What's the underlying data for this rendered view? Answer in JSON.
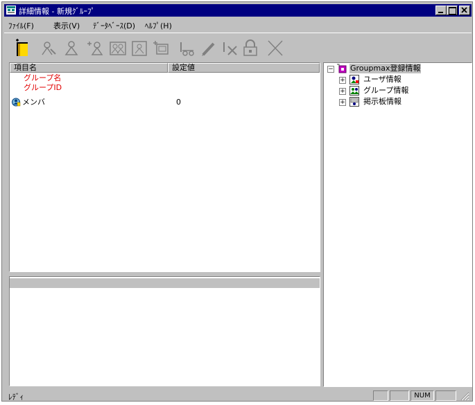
{
  "window": {
    "title": "詳細情報 - 新規ｸﾞﾙｰﾌﾟ"
  },
  "menu": [
    {
      "label": "ﾌｧｲﾙ(F)"
    },
    {
      "label": "表示(V)"
    },
    {
      "label": "ﾃﾞｰﾀﾍﾞｰｽ(D)"
    },
    {
      "label": "ﾍﾙﾌﾟ(H)"
    }
  ],
  "list": {
    "columns": [
      "項目名",
      "設定値"
    ],
    "rows": [
      {
        "name": "グループ名",
        "value": "",
        "color": "#e00000"
      },
      {
        "name": "グループID",
        "value": "",
        "color": "#e00000"
      },
      {
        "name": "メンバ",
        "value": "0",
        "icon": "member-icon"
      }
    ]
  },
  "tree": {
    "root": "Groupmax登録情報",
    "children": [
      {
        "label": "ユーザ情報",
        "icon": "user-info-icon"
      },
      {
        "label": "グループ情報",
        "icon": "group-info-icon"
      },
      {
        "label": "掲示板情報",
        "icon": "bulletin-info-icon"
      }
    ]
  },
  "status": {
    "text": "ﾚﾃﾞｨ",
    "num": "NUM"
  }
}
